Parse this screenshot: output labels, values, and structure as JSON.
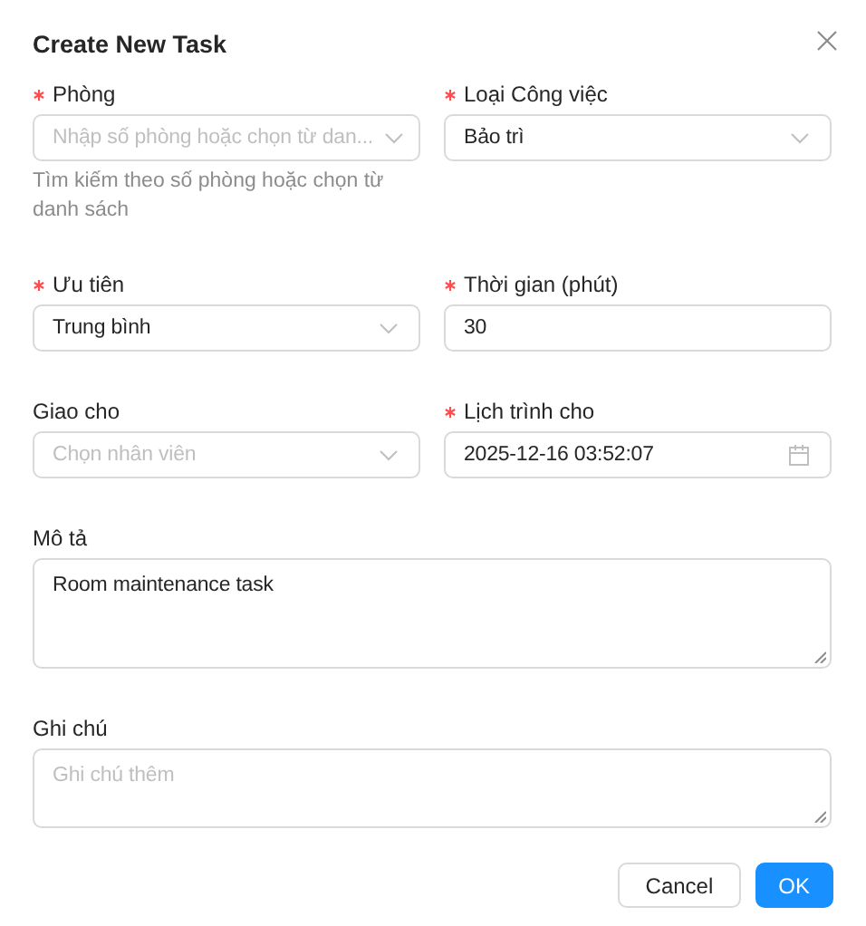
{
  "dialog": {
    "title": "Create New Task"
  },
  "fields": [
    {
      "kind": "select",
      "label": "Phòng",
      "required": true,
      "placeholder": "Nhập số phòng hoặc chọn từ dan...",
      "help": "Tìm kiếm theo số phòng hoặc chọn từ danh sách"
    },
    {
      "kind": "select",
      "label": "Loại Công việc",
      "required": true,
      "value": "Bảo trì"
    },
    {
      "kind": "select",
      "label": "Ưu tiên",
      "required": true,
      "value": "Trung bình"
    },
    {
      "kind": "number",
      "label": "Thời gian (phút)",
      "required": true,
      "value": "30"
    },
    {
      "kind": "select",
      "label": "Giao cho",
      "required": false,
      "placeholder": "Chọn nhân viên"
    },
    {
      "kind": "date",
      "label": "Lịch trình cho",
      "required": true,
      "value": "2025-12-16 03:52:07"
    },
    {
      "kind": "textarea",
      "label": "Mô tả",
      "required": false,
      "value": "Room maintenance task"
    },
    {
      "kind": "textarea",
      "label": "Ghi chú",
      "required": false,
      "placeholder": "Ghi chú thêm"
    }
  ],
  "buttons": [
    {
      "label": "Cancel",
      "primary": false
    },
    {
      "label": "OK",
      "primary": true
    }
  ]
}
